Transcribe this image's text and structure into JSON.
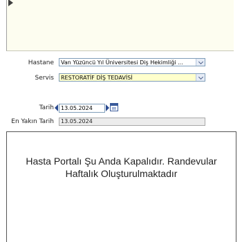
{
  "top_panel": {
    "expand_icon": "play-icon"
  },
  "form": {
    "hospital_label": "Hastane",
    "hospital_value": "Van Yüzüncü Yıl Üniversitesi Diş Hekimliği ...",
    "service_label": "Servis",
    "service_value": "RESTORATİF DİŞ TEDAVİSİ",
    "date_label": "Tarih",
    "date_value": "13.05.2024",
    "nearest_date_label": "En Yakın Tarih",
    "nearest_date_value": "13.05.2024"
  },
  "notice": {
    "message": "Hasta Portalı Şu Anda Kapalıdır. Randevular Haftalık Oluşturulmaktadır"
  },
  "colors": {
    "panel_bg": "#fdfdf0",
    "select_highlight": "#ffffcc",
    "input_border": "#7f9db9"
  }
}
